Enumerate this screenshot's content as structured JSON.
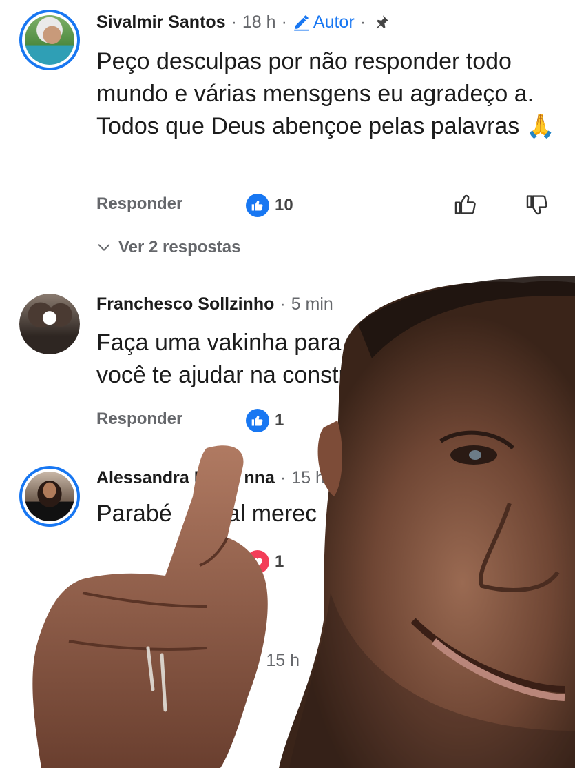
{
  "colors": {
    "accent": "#1877f2",
    "meta": "#65676b",
    "text": "#1c1c1c",
    "love": "#f33e58"
  },
  "comments": [
    {
      "author": "Sivalmir Santos",
      "time": "18 h",
      "sep1": "·",
      "sep2": "·",
      "sep3": "·",
      "author_badge": "Autor",
      "text": "Peço desculpas por não responder todo mundo e várias mensgens eu agradeço a. Todos que Deus abençoe pelas palavras 🙏",
      "reply_label": "Responder",
      "reaction_icon": "like-icon",
      "reaction_count": "10",
      "view_replies": "Ver 2 respostas"
    },
    {
      "author": "Franchesco Sollzinho",
      "time": "5 min",
      "sep1": "·",
      "text": "Faça uma vakinha para quem você te ajudar na construçã",
      "reply_label": "Responder",
      "reaction_icon": "like-icon",
      "reaction_count": "1"
    },
    {
      "author_a": "Alessandra P",
      "author_b": "nna",
      "time": "15 h",
      "sep1": "·",
      "text_a": "Parabé",
      "text_b": "Val merec",
      "reaction_icon": "love-icon",
      "reaction_count": "1"
    },
    {
      "sep1": "·",
      "time": "15 h"
    }
  ]
}
